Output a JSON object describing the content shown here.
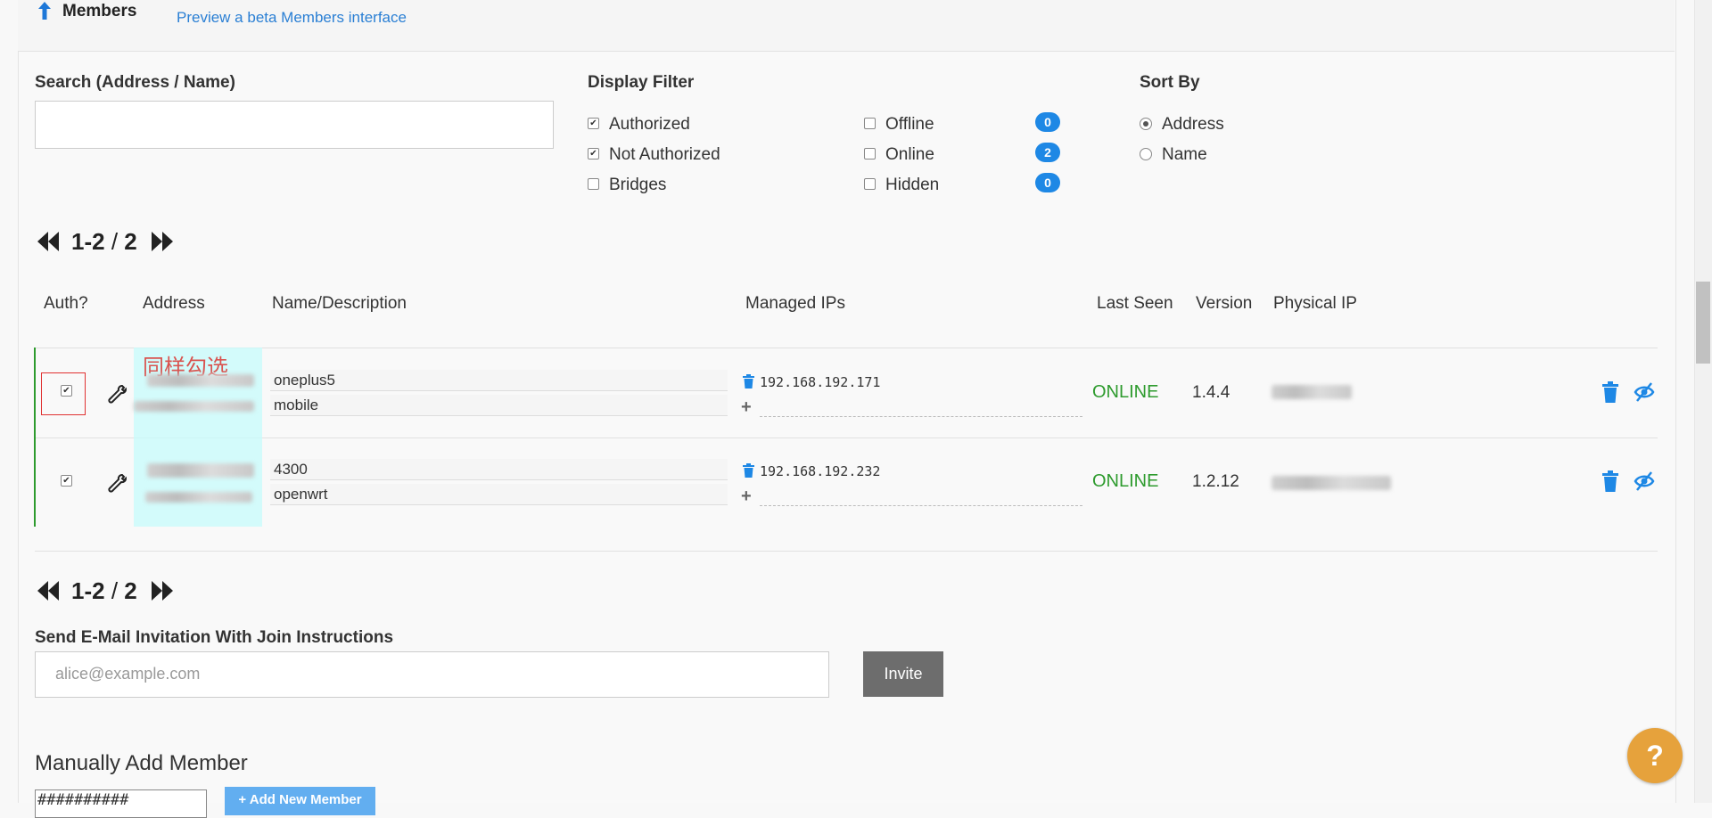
{
  "header": {
    "title": "Members",
    "beta_link": "Preview a beta Members interface"
  },
  "search": {
    "label": "Search (Address / Name)",
    "value": ""
  },
  "display_filter": {
    "label": "Display Filter",
    "options": [
      {
        "label": "Authorized",
        "checked": true
      },
      {
        "label": "Not Authorized",
        "checked": true
      },
      {
        "label": "Bridges",
        "checked": false
      },
      {
        "label": "Offline",
        "checked": false,
        "count": "0"
      },
      {
        "label": "Online",
        "checked": false,
        "count": "2"
      },
      {
        "label": "Hidden",
        "checked": false,
        "count": "0"
      }
    ]
  },
  "sort_by": {
    "label": "Sort By",
    "options": [
      {
        "label": "Address",
        "selected": true
      },
      {
        "label": "Name",
        "selected": false
      }
    ]
  },
  "pager": {
    "range": "1-2",
    "sep": "/",
    "total": "2"
  },
  "table": {
    "headers": [
      "Auth?",
      "Address",
      "Name/Description",
      "Managed IPs",
      "Last Seen",
      "Version",
      "Physical IP"
    ],
    "rows": [
      {
        "authorized": true,
        "name": "oneplus5",
        "description": "mobile",
        "managed_ip": "192.168.192.171",
        "last_seen": "ONLINE",
        "version": "1.4.4"
      },
      {
        "authorized": true,
        "name": "4300",
        "description": "openwrt",
        "managed_ip": "192.168.192.232",
        "last_seen": "ONLINE",
        "version": "1.2.12"
      }
    ]
  },
  "annotation": {
    "text": "同样勾选"
  },
  "invite": {
    "label": "Send E-Mail Invitation With Join Instructions",
    "placeholder": "alice@example.com",
    "button": "Invite"
  },
  "manual_add": {
    "title": "Manually Add Member",
    "input_value": "##########",
    "button": "+ Add New Member"
  },
  "help": {
    "label": "?"
  },
  "colors": {
    "accent": "#1e88e5",
    "online": "#2e9b2e",
    "help": "#e6a23c",
    "annotation": "#e03131"
  }
}
